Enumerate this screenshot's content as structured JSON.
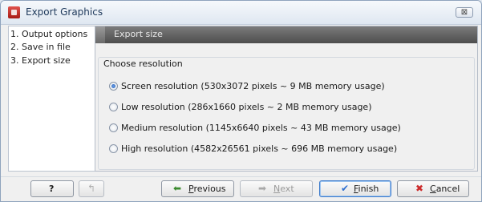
{
  "window": {
    "title": "Export Graphics",
    "close_glyph": "⊠"
  },
  "steps": [
    {
      "label": "1. Output options"
    },
    {
      "label": "2. Save in file"
    },
    {
      "label": "3. Export size"
    }
  ],
  "panel": {
    "header": "Export size",
    "group_label": "Choose resolution",
    "options": [
      {
        "label": "Screen resolution (530x3072 pixels ~ 9 MB memory usage)",
        "checked": true
      },
      {
        "label": "Low resolution (286x1660 pixels ~ 2 MB memory usage)",
        "checked": false
      },
      {
        "label": "Medium resolution (1145x6640 pixels ~ 43 MB memory usage)",
        "checked": false
      },
      {
        "label": "High resolution (4582x26561 pixels ~ 696 MB memory usage)",
        "checked": false
      }
    ]
  },
  "buttons": {
    "help": "?",
    "previous": "Previous",
    "next": "Next",
    "finish": "Finish",
    "cancel": "Cancel"
  },
  "icons": {
    "app": "app-icon",
    "help": "help-icon",
    "reset": "reset-icon",
    "previous": "left-arrow-icon",
    "next": "right-arrow-icon",
    "finish": "checkmark-icon",
    "cancel": "x-icon"
  },
  "colors": {
    "accent": "#1f5bb5",
    "header_bg": "#5a5a5a",
    "app_icon": "#c0302a",
    "finish_check": "#2f6fd0",
    "cancel_x": "#cc2b2b"
  }
}
